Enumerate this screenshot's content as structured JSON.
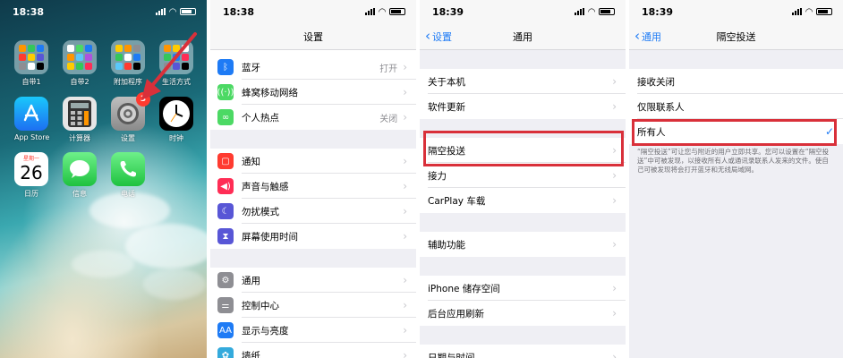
{
  "colors": {
    "accent": "#1e7bf5",
    "highlight": "#d9303a",
    "badge": "#ff3b30"
  },
  "panel1": {
    "time": "18:38",
    "apps": [
      {
        "label": "自带1",
        "icon": "folder-icon"
      },
      {
        "label": "自带2",
        "icon": "folder-icon"
      },
      {
        "label": "附加程序",
        "icon": "folder-icon"
      },
      {
        "label": "生活方式",
        "icon": "folder-icon"
      },
      {
        "label": "App Store",
        "icon": "app-store-icon"
      },
      {
        "label": "计算器",
        "icon": "calculator-icon"
      },
      {
        "label": "设置",
        "icon": "settings-gear-icon",
        "badge": "3"
      },
      {
        "label": "时钟",
        "icon": "clock-icon"
      },
      {
        "label": "日历",
        "icon": "calendar-icon",
        "day_name": "星期一",
        "day": "26"
      },
      {
        "label": "信息",
        "icon": "messages-icon"
      },
      {
        "label": "电话",
        "icon": "phone-icon"
      }
    ]
  },
  "panel2": {
    "time": "18:38",
    "title": "设置",
    "rows": [
      {
        "label": "蓝牙",
        "value": "打开",
        "icon": "bluetooth-icon",
        "color": "#1e7bf5"
      },
      {
        "label": "蜂窝移动网络",
        "value": "",
        "icon": "cellular-icon",
        "color": "#4cd964"
      },
      {
        "label": "个人热点",
        "value": "关闭",
        "icon": "hotspot-icon",
        "color": "#4cd964"
      },
      {
        "label": "通知",
        "value": "",
        "icon": "notification-icon",
        "color": "#ff3b30"
      },
      {
        "label": "声音与触感",
        "value": "",
        "icon": "sound-icon",
        "color": "#ff2d55"
      },
      {
        "label": "勿扰模式",
        "value": "",
        "icon": "moon-icon",
        "color": "#5856d6"
      },
      {
        "label": "屏幕使用时间",
        "value": "",
        "icon": "hourglass-icon",
        "color": "#5856d6"
      },
      {
        "label": "通用",
        "value": "",
        "icon": "gear-icon",
        "color": "#8e8e93"
      },
      {
        "label": "控制中心",
        "value": "",
        "icon": "control-center-icon",
        "color": "#8e8e93"
      },
      {
        "label": "显示与亮度",
        "value": "",
        "icon": "display-icon",
        "color": "#1e7bf5"
      },
      {
        "label": "墙纸",
        "value": "",
        "icon": "wallpaper-icon",
        "color": "#34aadc"
      }
    ]
  },
  "panel3": {
    "time": "18:39",
    "back": "设置",
    "title": "通用",
    "rows": [
      {
        "label": "关于本机"
      },
      {
        "label": "软件更新"
      },
      {
        "label": "隔空投送"
      },
      {
        "label": "接力"
      },
      {
        "label": "CarPlay 车载"
      },
      {
        "label": "辅助功能"
      },
      {
        "label": "iPhone 储存空间"
      },
      {
        "label": "后台应用刷新"
      },
      {
        "label": "日期与时间"
      }
    ]
  },
  "panel4": {
    "time": "18:39",
    "back": "通用",
    "title": "隔空投送",
    "options": [
      {
        "label": "接收关闭"
      },
      {
        "label": "仅限联系人"
      },
      {
        "label": "所有人",
        "checkmark": "✓"
      }
    ],
    "footnote": "“隔空投送”可让您与附近的用户立即共享。您可以设置在“隔空投送”中可被发现，以接收所有人或通讯录联系人发来的文件。使自己可被发现将会打开蓝牙和无线局域网。"
  }
}
